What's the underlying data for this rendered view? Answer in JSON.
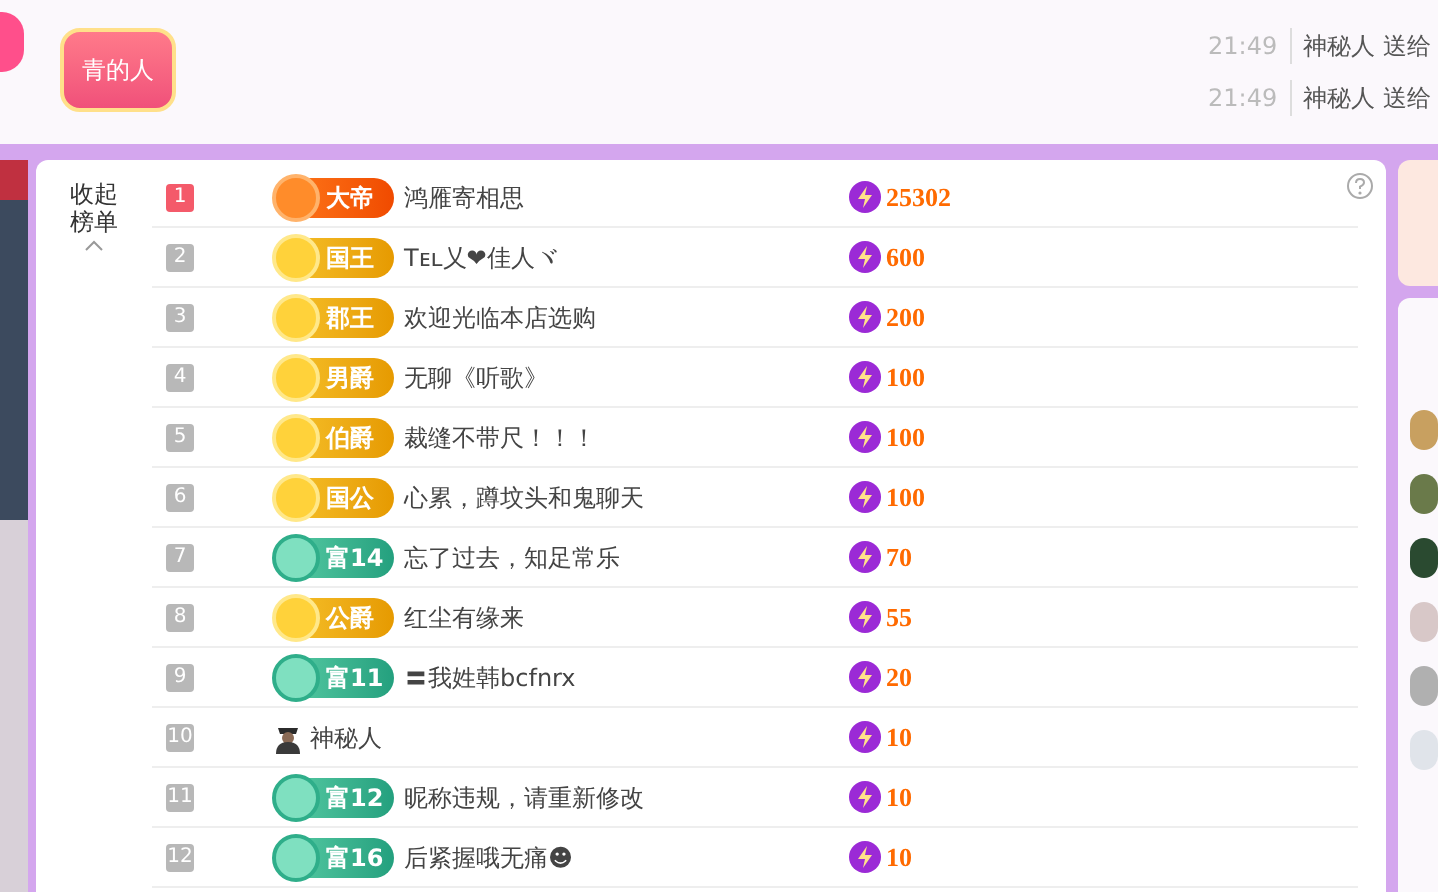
{
  "header": {
    "badge": "青的人",
    "messages": [
      {
        "time": "21:49",
        "text": "神秘人 送给"
      },
      {
        "time": "21:49",
        "text": "神秘人 送给"
      }
    ]
  },
  "ranking": {
    "collapse_label": "收起榜单",
    "rows": [
      {
        "rank": "1",
        "highlighted": true,
        "kind": "emperor",
        "title": "大帝",
        "name": "鸿雁寄相思",
        "value": "25302"
      },
      {
        "rank": "2",
        "highlighted": false,
        "kind": "noble",
        "title": "国王",
        "name": "Tᴇʟ乂❤佳人ヾ",
        "value": "600"
      },
      {
        "rank": "3",
        "highlighted": false,
        "kind": "noble",
        "title": "郡王",
        "name": "欢迎光临本店选购",
        "value": "200"
      },
      {
        "rank": "4",
        "highlighted": false,
        "kind": "noble",
        "title": "男爵",
        "name": "无聊《听歌》",
        "value": "100"
      },
      {
        "rank": "5",
        "highlighted": false,
        "kind": "noble",
        "title": "伯爵",
        "name": "裁缝不带尺！！！",
        "value": "100"
      },
      {
        "rank": "6",
        "highlighted": false,
        "kind": "noble",
        "title": "国公",
        "name": "心累，蹲坟头和鬼聊天",
        "value": "100"
      },
      {
        "rank": "7",
        "highlighted": false,
        "kind": "rich",
        "title": "富14",
        "name": "忘了过去，知足常乐",
        "value": "70"
      },
      {
        "rank": "8",
        "highlighted": false,
        "kind": "noble",
        "title": "公爵",
        "name": "红尘有缘来",
        "value": "55"
      },
      {
        "rank": "9",
        "highlighted": false,
        "kind": "rich",
        "title": "富11",
        "name": "〓我姓韩bcfnrx",
        "value": "20"
      },
      {
        "rank": "10",
        "highlighted": false,
        "kind": "mystery",
        "name": "神秘人",
        "value": "10"
      },
      {
        "rank": "11",
        "highlighted": false,
        "kind": "rich",
        "title": "富12",
        "name": "昵称违规，请重新修改",
        "value": "10"
      },
      {
        "rank": "12",
        "highlighted": false,
        "kind": "rich",
        "title": "富16",
        "name": "后紧握哦无痛☻",
        "value": "10"
      }
    ]
  }
}
